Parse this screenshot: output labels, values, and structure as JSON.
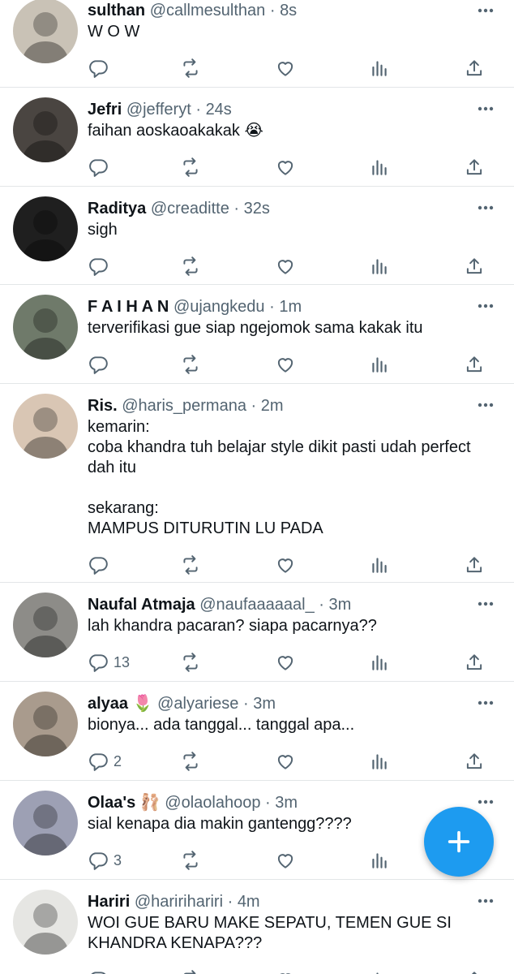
{
  "tweets": [
    {
      "name": "sulthan",
      "handle": "@callmesulthan",
      "time": "8s",
      "text": "W O W",
      "reply_count": "",
      "avatar_tone": "#c9c2b6"
    },
    {
      "name": "Jefri",
      "handle": "@jefferyt",
      "time": "24s",
      "text": "faihan aoskaoakakak 😭",
      "reply_count": "",
      "avatar_tone": "#4a4541"
    },
    {
      "name": "Raditya",
      "handle": "@creaditte",
      "time": "32s",
      "text": "sigh",
      "reply_count": "",
      "avatar_tone": "#1f1f1f"
    },
    {
      "name": "F A I H A N",
      "handle": "@ujangkedu",
      "time": "1m",
      "text": "terverifikasi gue siap ngejomok sama kakak itu",
      "reply_count": "",
      "avatar_tone": "#6f7a6a"
    },
    {
      "name": "Ris.",
      "handle": "@haris_permana",
      "time": "2m",
      "text": "kemarin:\ncoba khandra tuh belajar style dikit pasti udah perfect dah itu\n\nsekarang:\nMAMPUS DITURUTIN LU PADA",
      "reply_count": "",
      "avatar_tone": "#d9c6b4"
    },
    {
      "name": "Naufal Atmaja",
      "handle": "@naufaaaaaal_",
      "time": "3m",
      "text": "lah khandra pacaran? siapa pacarnya??",
      "reply_count": "13",
      "avatar_tone": "#8d8c88"
    },
    {
      "name": "alyaa 🌷",
      "handle": "@alyariese",
      "time": "3m",
      "text": "bionya... ada tanggal... tanggal apa...",
      "reply_count": "2",
      "avatar_tone": "#a99b8d"
    },
    {
      "name": "Olaa's 🩰",
      "handle": "@olaolahoop",
      "time": "3m",
      "text": "sial kenapa dia makin gantengg????",
      "reply_count": "3",
      "avatar_tone": "#9da0b4"
    },
    {
      "name": "Hariri",
      "handle": "@haririhariri",
      "time": "4m",
      "text": "WOI GUE BARU MAKE SEPATU, TEMEN GUE SI KHANDRA KENAPA???",
      "reply_count": "",
      "avatar_tone": "#e6e6e3"
    }
  ],
  "compose_icon": "plus-icon",
  "colors": {
    "accent": "#1d9bf0",
    "secondary_text": "#536471",
    "divider": "#e3e6e8"
  }
}
